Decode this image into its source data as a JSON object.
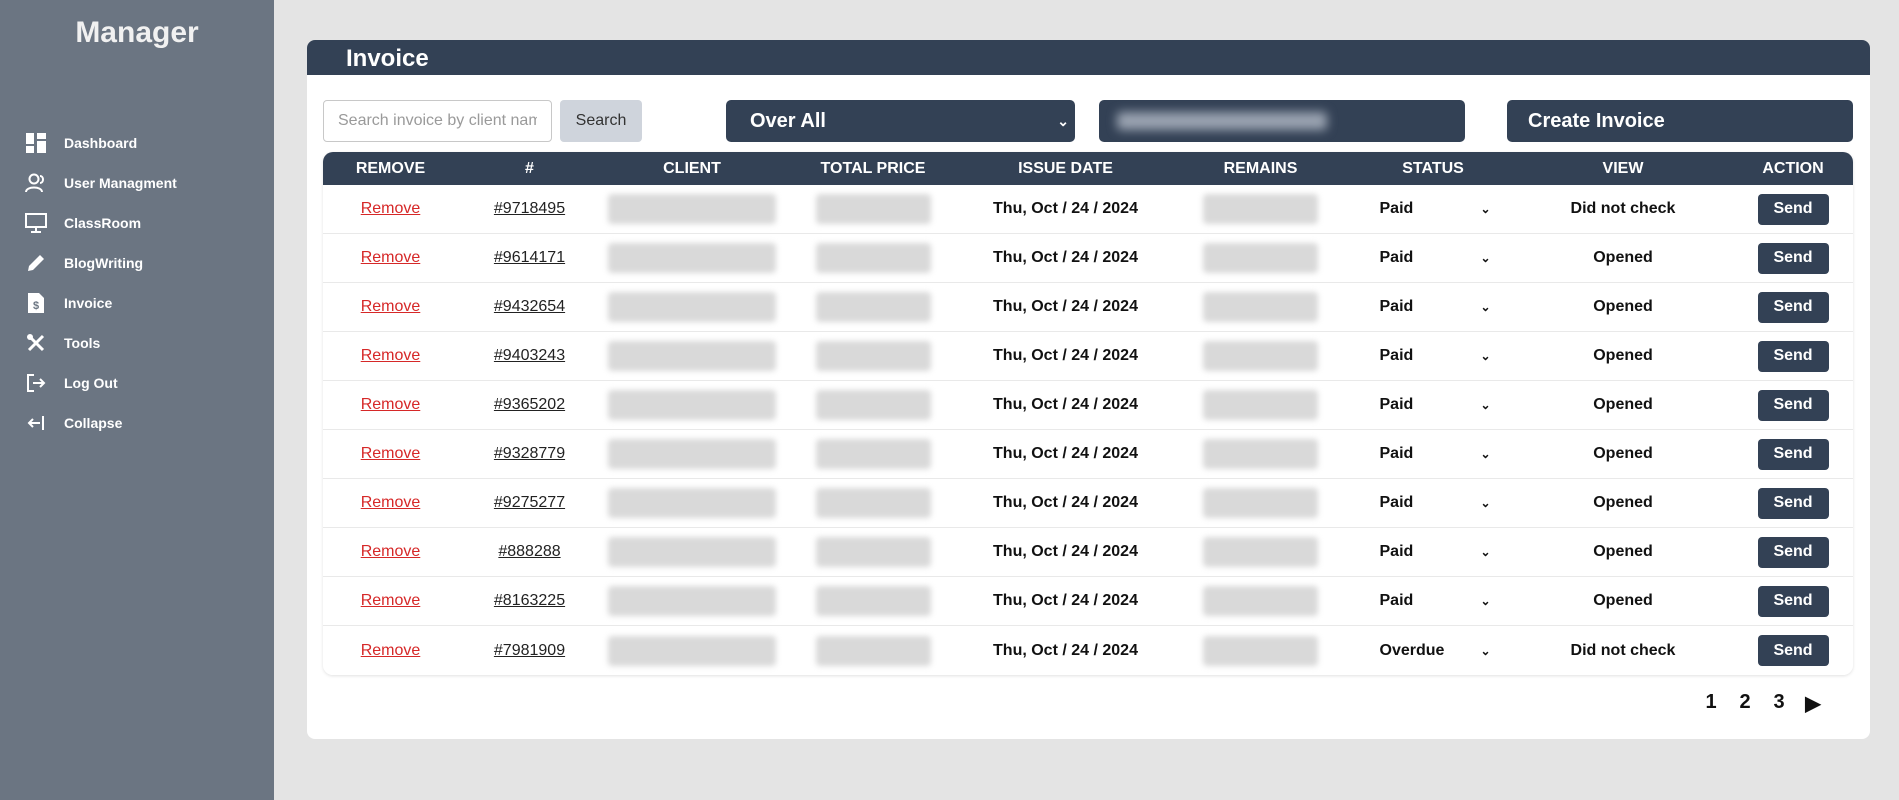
{
  "app": {
    "brand": "Manager"
  },
  "sidebar": {
    "items": [
      {
        "label": "Dashboard",
        "icon": "dashboard-icon"
      },
      {
        "label": "User Managment",
        "icon": "users-icon"
      },
      {
        "label": "ClassRoom",
        "icon": "presentation-icon"
      },
      {
        "label": "BlogWriting",
        "icon": "pencil-icon"
      },
      {
        "label": "Invoice",
        "icon": "invoice-icon"
      },
      {
        "label": "Tools",
        "icon": "tools-icon"
      },
      {
        "label": "Log Out",
        "icon": "logout-icon"
      },
      {
        "label": "Collapse",
        "icon": "collapse-icon"
      }
    ]
  },
  "page": {
    "title": "Invoice"
  },
  "toolbar": {
    "search_placeholder": "Search invoice by client name",
    "search_label": "Search",
    "filter_value": "Over All",
    "create_label": "Create Invoice"
  },
  "table": {
    "headers": [
      "REMOVE",
      "#",
      "CLIENT",
      "TOTAL PRICE",
      "ISSUE DATE",
      "REMAINS",
      "STATUS",
      "VIEW",
      "ACTION"
    ],
    "rows": [
      {
        "remove": "Remove",
        "id": "#9718495",
        "date": "Thu, Oct / 24 / 2024",
        "status": "Paid",
        "view": "Did not check",
        "action": "Send"
      },
      {
        "remove": "Remove",
        "id": "#9614171",
        "date": "Thu, Oct / 24 / 2024",
        "status": "Paid",
        "view": "Opened",
        "action": "Send"
      },
      {
        "remove": "Remove",
        "id": "#9432654",
        "date": "Thu, Oct / 24 / 2024",
        "status": "Paid",
        "view": "Opened",
        "action": "Send"
      },
      {
        "remove": "Remove",
        "id": "#9403243",
        "date": "Thu, Oct / 24 / 2024",
        "status": "Paid",
        "view": "Opened",
        "action": "Send"
      },
      {
        "remove": "Remove",
        "id": "#9365202",
        "date": "Thu, Oct / 24 / 2024",
        "status": "Paid",
        "view": "Opened",
        "action": "Send"
      },
      {
        "remove": "Remove",
        "id": "#9328779",
        "date": "Thu, Oct / 24 / 2024",
        "status": "Paid",
        "view": "Opened",
        "action": "Send"
      },
      {
        "remove": "Remove",
        "id": "#9275277",
        "date": "Thu, Oct / 24 / 2024",
        "status": "Paid",
        "view": "Opened",
        "action": "Send"
      },
      {
        "remove": "Remove",
        "id": "#888288",
        "date": "Thu, Oct / 24 / 2024",
        "status": "Paid",
        "view": "Opened",
        "action": "Send"
      },
      {
        "remove": "Remove",
        "id": "#8163225",
        "date": "Thu, Oct / 24 / 2024",
        "status": "Paid",
        "view": "Opened",
        "action": "Send"
      },
      {
        "remove": "Remove",
        "id": "#7981909",
        "date": "Thu, Oct / 24 / 2024",
        "status": "Overdue",
        "view": "Did not check",
        "action": "Send"
      }
    ]
  },
  "pagination": {
    "pages": [
      "1",
      "2",
      "3"
    ],
    "next": "▶"
  },
  "colors": {
    "accent": "#334155",
    "sidebar": "#6b7582",
    "remove": "#d62828"
  }
}
